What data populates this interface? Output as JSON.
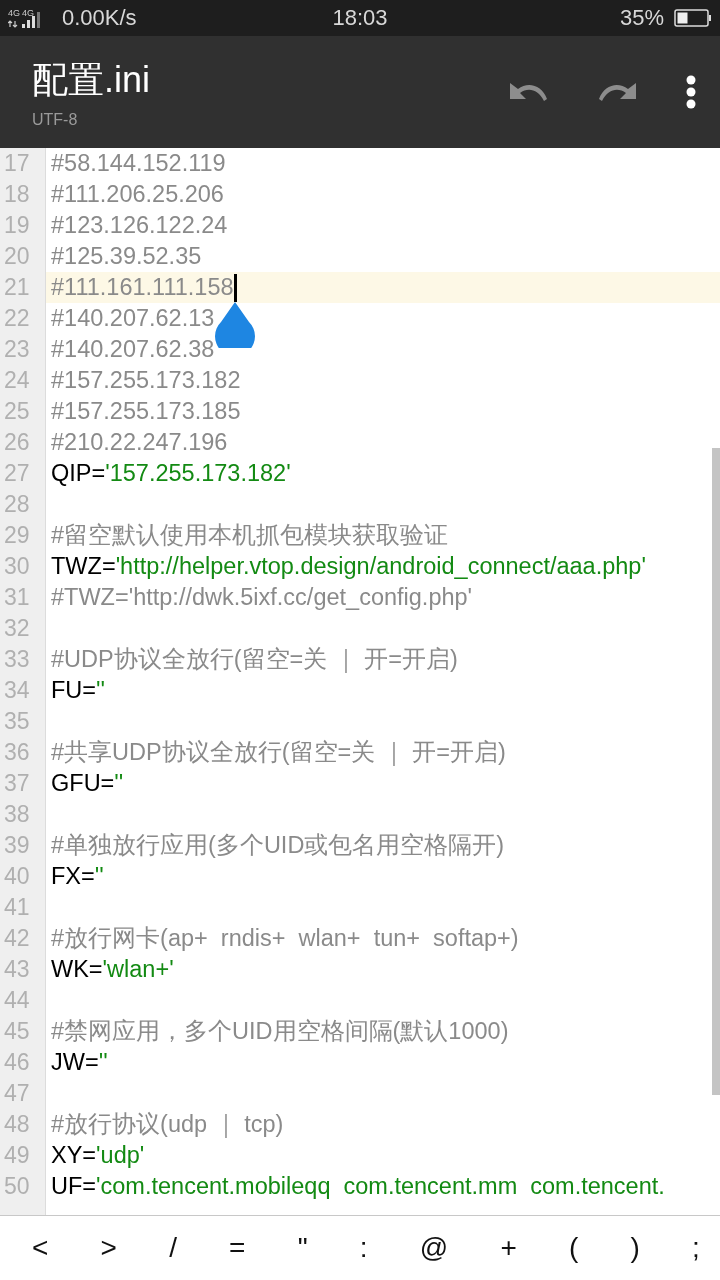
{
  "status_bar": {
    "signal_labels": [
      "4G",
      "4G"
    ],
    "network": "0.00K/s",
    "time": "18:03",
    "battery": "35%"
  },
  "toolbar": {
    "title": "配置.ini",
    "subtitle": "UTF-8"
  },
  "editor": {
    "lines": [
      {
        "number": "17",
        "current": false,
        "parts": [
          {
            "kind": "comment",
            "text": "#58.144.152.119"
          }
        ]
      },
      {
        "number": "18",
        "current": false,
        "parts": [
          {
            "kind": "comment",
            "text": "#111.206.25.206"
          }
        ]
      },
      {
        "number": "19",
        "current": false,
        "parts": [
          {
            "kind": "comment",
            "text": "#123.126.122.24"
          }
        ]
      },
      {
        "number": "20",
        "current": false,
        "parts": [
          {
            "kind": "comment",
            "text": "#125.39.52.35"
          }
        ]
      },
      {
        "number": "21",
        "current": true,
        "parts": [
          {
            "kind": "comment",
            "text": "#111.161.111.158"
          }
        ]
      },
      {
        "number": "22",
        "current": false,
        "parts": [
          {
            "kind": "comment",
            "text": "#140.207.62.13"
          }
        ]
      },
      {
        "number": "23",
        "current": false,
        "parts": [
          {
            "kind": "comment",
            "text": "#140.207.62.38"
          }
        ]
      },
      {
        "number": "24",
        "current": false,
        "parts": [
          {
            "kind": "comment",
            "text": "#157.255.173.182"
          }
        ]
      },
      {
        "number": "25",
        "current": false,
        "parts": [
          {
            "kind": "comment",
            "text": "#157.255.173.185"
          }
        ]
      },
      {
        "number": "26",
        "current": false,
        "parts": [
          {
            "kind": "comment",
            "text": "#210.22.247.196"
          }
        ]
      },
      {
        "number": "27",
        "current": false,
        "parts": [
          {
            "kind": "key",
            "text": "QIP="
          },
          {
            "kind": "string",
            "text": "'157.255.173.182'"
          }
        ]
      },
      {
        "number": "28",
        "current": false
      },
      {
        "number": "29",
        "current": false,
        "parts": [
          {
            "kind": "comment",
            "text": "#留空默认使用本机抓包模块获取验证"
          }
        ]
      },
      {
        "number": "30",
        "current": false,
        "parts": [
          {
            "kind": "key",
            "text": "TWZ="
          },
          {
            "kind": "string",
            "text": "'http://helper.vtop.design/android_connect/aaa.php'"
          }
        ]
      },
      {
        "number": "31",
        "current": false,
        "parts": [
          {
            "kind": "comment",
            "text": "#TWZ='http://dwk.5ixf.cc/get_config.php'"
          }
        ]
      },
      {
        "number": "32",
        "current": false
      },
      {
        "number": "33",
        "current": false,
        "parts": [
          {
            "kind": "comment",
            "text": "#UDP协议全放行(留空=关 ｜ 开=开启)"
          }
        ]
      },
      {
        "number": "34",
        "current": false,
        "parts": [
          {
            "kind": "key",
            "text": "FU="
          },
          {
            "kind": "string",
            "text": "''"
          }
        ]
      },
      {
        "number": "35",
        "current": false
      },
      {
        "number": "36",
        "current": false,
        "parts": [
          {
            "kind": "comment",
            "text": "#共享UDP协议全放行(留空=关 ｜ 开=开启)"
          }
        ]
      },
      {
        "number": "37",
        "current": false,
        "parts": [
          {
            "kind": "key",
            "text": "GFU="
          },
          {
            "kind": "string",
            "text": "''"
          }
        ]
      },
      {
        "number": "38",
        "current": false
      },
      {
        "number": "39",
        "current": false,
        "parts": [
          {
            "kind": "comment",
            "text": "#单独放行应用(多个UID或包名用空格隔开)"
          }
        ]
      },
      {
        "number": "40",
        "current": false,
        "parts": [
          {
            "kind": "key",
            "text": "FX="
          },
          {
            "kind": "string",
            "text": "''"
          }
        ]
      },
      {
        "number": "41",
        "current": false
      },
      {
        "number": "42",
        "current": false,
        "parts": [
          {
            "kind": "comment",
            "text": "#放行网卡(ap+  rndis+  wlan+  tun+  softap+)"
          }
        ]
      },
      {
        "number": "43",
        "current": false,
        "parts": [
          {
            "kind": "key",
            "text": "WK="
          },
          {
            "kind": "string",
            "text": "'wlan+'"
          }
        ]
      },
      {
        "number": "44",
        "current": false
      },
      {
        "number": "45",
        "current": false,
        "parts": [
          {
            "kind": "comment",
            "text": "#禁网应用，多个UID用空格间隔(默认1000)"
          }
        ]
      },
      {
        "number": "46",
        "current": false,
        "parts": [
          {
            "kind": "key",
            "text": "JW="
          },
          {
            "kind": "string",
            "text": "''"
          }
        ]
      },
      {
        "number": "47",
        "current": false
      },
      {
        "number": "48",
        "current": false,
        "parts": [
          {
            "kind": "comment",
            "text": "#放行协议(udp ｜ tcp)"
          }
        ]
      },
      {
        "number": "49",
        "current": false,
        "parts": [
          {
            "kind": "key",
            "text": "XY="
          },
          {
            "kind": "string",
            "text": "'udp'"
          }
        ]
      },
      {
        "number": "50",
        "current": false,
        "parts": [
          {
            "kind": "key",
            "text": "UF="
          },
          {
            "kind": "string",
            "text": "'com.tencent.mobileqq  com.tencent.mm  com.tencent."
          }
        ]
      }
    ]
  },
  "symbol_keys": [
    "<",
    ">",
    "/",
    "=",
    "\"",
    ":",
    "@",
    "+",
    "(",
    ")",
    ";"
  ]
}
